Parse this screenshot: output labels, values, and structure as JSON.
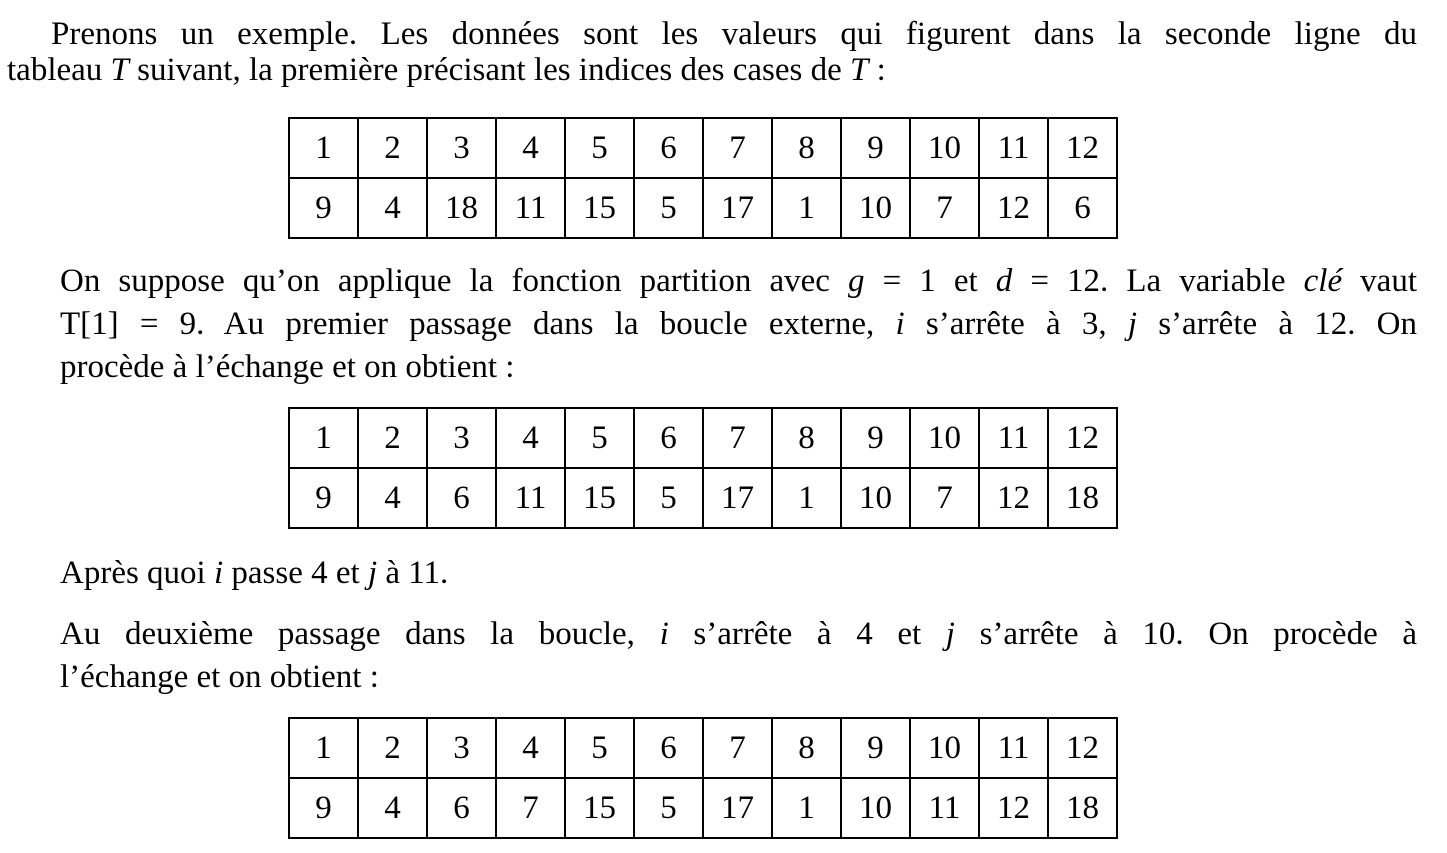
{
  "paragraphs": {
    "intro_line1": "Prenons un exemple. Les données sont les valeurs qui figurent dans la seconde ligne du",
    "intro_line2_a": "tableau ",
    "intro_line2_T": "T",
    "intro_line2_b": " suivant, la première précisant les indices des cases de ",
    "intro_line2_T2": "T",
    "intro_line2_c": " :",
    "p2_line1_a": "On suppose qu’on applique la fonction partition avec ",
    "p2_line1_g": "g",
    "p2_line1_b": " = 1 et ",
    "p2_line1_d": "d",
    "p2_line1_c": " = 12. La variable ",
    "p2_line1_cle": "clé",
    "p2_line1_e": " vaut",
    "p2_line2_a": "T[1] = 9. Au premier passage dans la boucle externe, ",
    "p2_line2_i": "i",
    "p2_line2_b": " s’arrête à 3, ",
    "p2_line2_j": "j",
    "p2_line2_c": " s’arrête à 12. On",
    "p2_line3": "procède à l’échange et on obtient :",
    "p3_a": "Après quoi ",
    "p3_i": "i",
    "p3_b": " passe 4 et ",
    "p3_j": "j",
    "p3_c": " à 11.",
    "p4_line1_a": "Au deuxième passage dans la boucle, ",
    "p4_line1_i": "i",
    "p4_line1_b": " s’arrête à 4 et ",
    "p4_line1_j": "j",
    "p4_line1_c": " s’arrête à 10. On procède à",
    "p4_line2": "l’échange et on obtient :"
  },
  "tables": [
    {
      "indices": [
        "1",
        "2",
        "3",
        "4",
        "5",
        "6",
        "7",
        "8",
        "9",
        "10",
        "11",
        "12"
      ],
      "values": [
        "9",
        "4",
        "18",
        "11",
        "15",
        "5",
        "17",
        "1",
        "10",
        "7",
        "12",
        "6"
      ]
    },
    {
      "indices": [
        "1",
        "2",
        "3",
        "4",
        "5",
        "6",
        "7",
        "8",
        "9",
        "10",
        "11",
        "12"
      ],
      "values": [
        "9",
        "4",
        "6",
        "11",
        "15",
        "5",
        "17",
        "1",
        "10",
        "7",
        "12",
        "18"
      ]
    },
    {
      "indices": [
        "1",
        "2",
        "3",
        "4",
        "5",
        "6",
        "7",
        "8",
        "9",
        "10",
        "11",
        "12"
      ],
      "values": [
        "9",
        "4",
        "6",
        "7",
        "15",
        "5",
        "17",
        "1",
        "10",
        "11",
        "12",
        "18"
      ]
    }
  ]
}
